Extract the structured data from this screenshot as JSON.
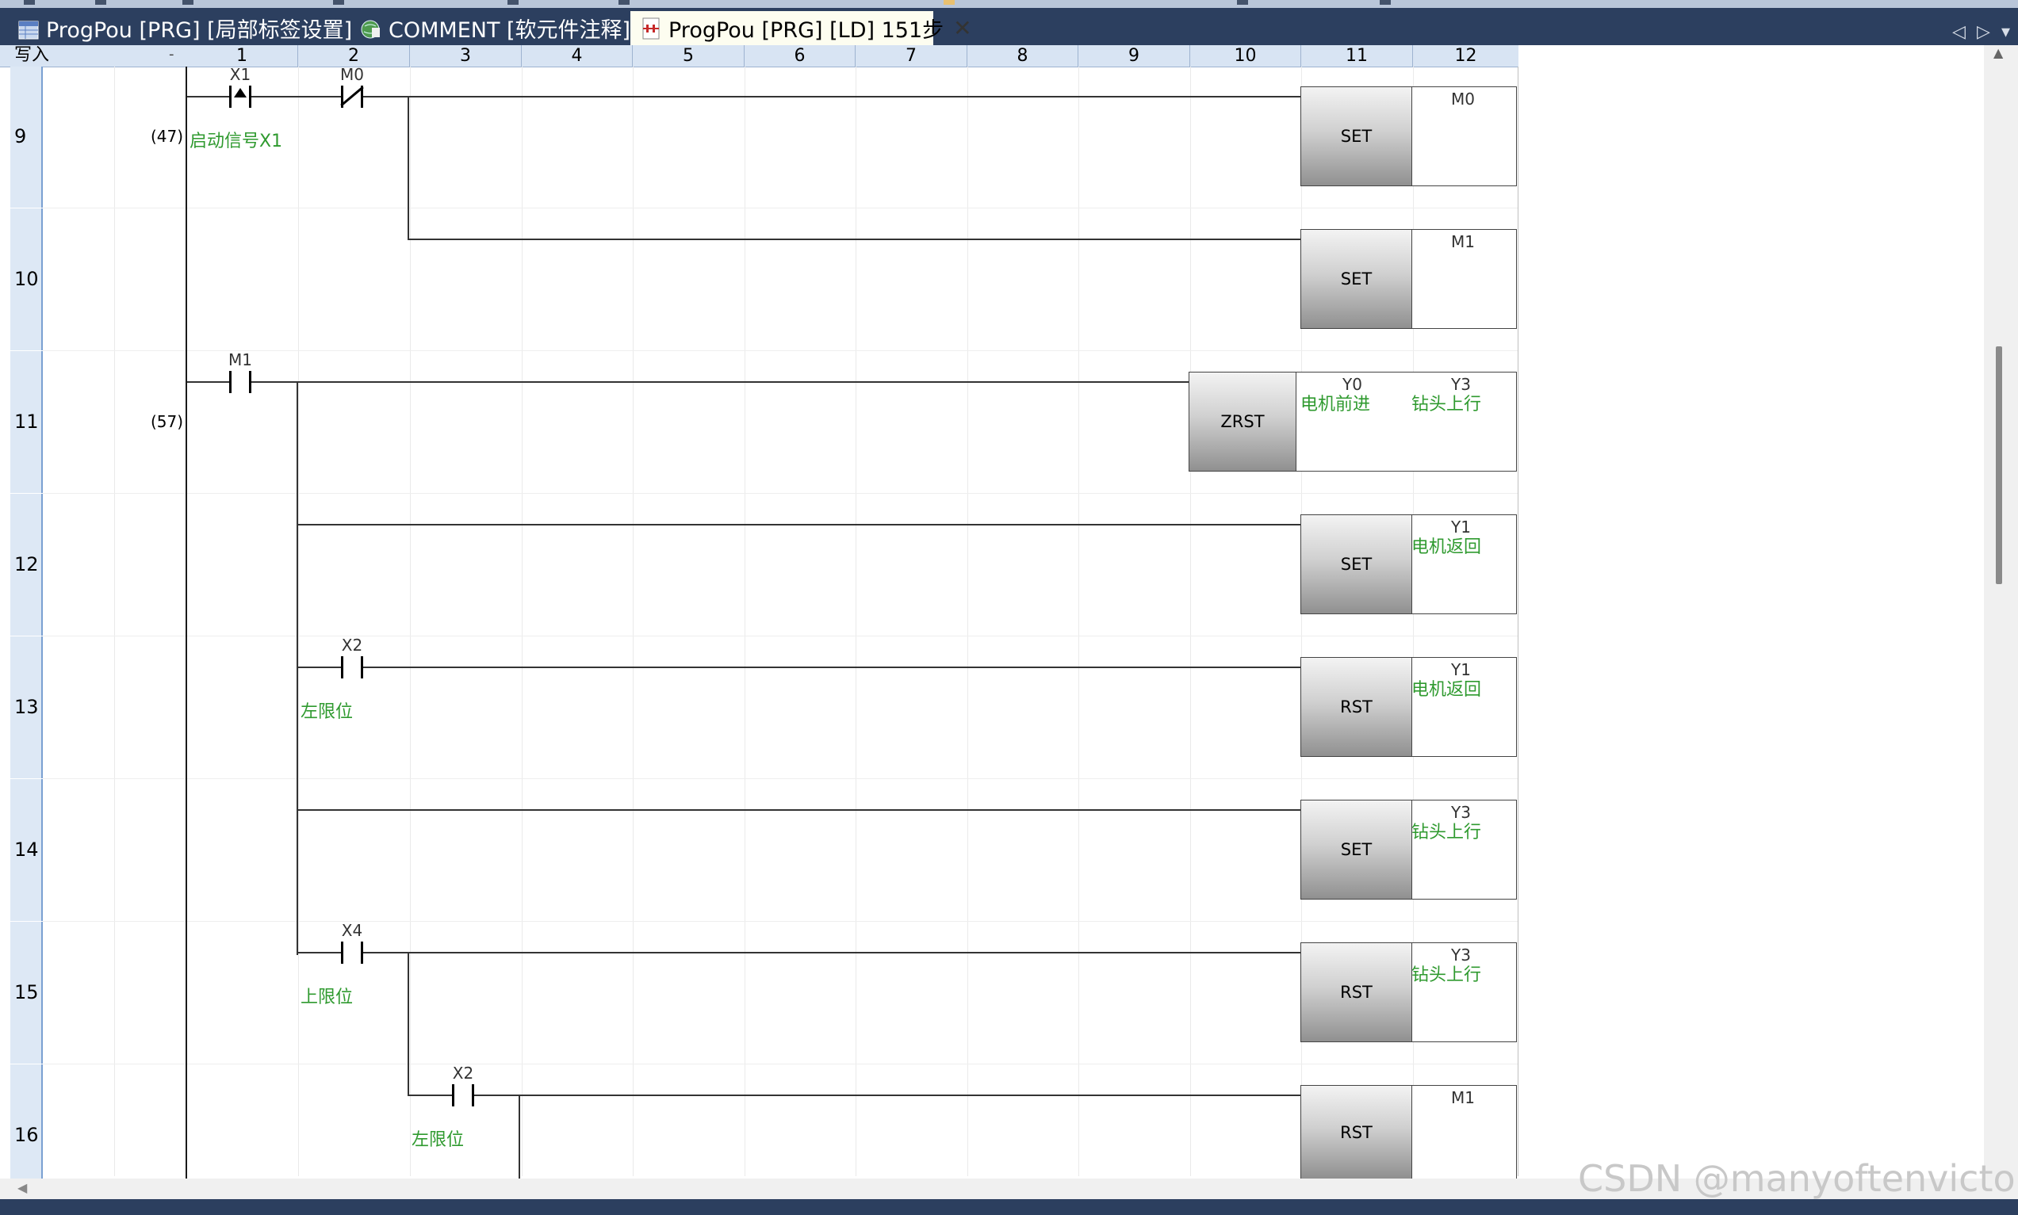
{
  "tabs": [
    {
      "label": "ProgPou [PRG] [局部标签设置]",
      "active": false,
      "icon": "label-table-icon"
    },
    {
      "label": "COMMENT [软元件注释]",
      "active": false,
      "icon": "globe-comment-icon"
    },
    {
      "label": "ProgPou [PRG] [LD] 151步",
      "active": true,
      "icon": "ladder-doc-icon"
    }
  ],
  "header": {
    "mode_label": "写入",
    "dash": "-",
    "columns": [
      "1",
      "2",
      "3",
      "4",
      "5",
      "6",
      "7",
      "8",
      "9",
      "10",
      "11",
      "12"
    ]
  },
  "rows": [
    "9",
    "10",
    "11",
    "12",
    "13",
    "14",
    "15",
    "16"
  ],
  "steps": [
    "(47)",
    "(57)"
  ],
  "contacts": [
    {
      "device": "X1",
      "type": "rising-edge",
      "comment": "启动信号X1"
    },
    {
      "device": "M0",
      "type": "normally-closed",
      "comment": ""
    },
    {
      "device": "M1",
      "type": "normally-open",
      "comment": ""
    },
    {
      "device": "X2",
      "type": "normally-open",
      "comment": "左限位"
    },
    {
      "device": "X4",
      "type": "normally-open",
      "comment": "上限位"
    },
    {
      "device": "X2",
      "type": "normally-open",
      "comment": "左限位"
    }
  ],
  "instructions": [
    {
      "op": "SET",
      "operand": "M0",
      "comment": ""
    },
    {
      "op": "SET",
      "operand": "M1",
      "comment": ""
    },
    {
      "op": "ZRST",
      "operand1": "Y0",
      "comment1": "电机前进",
      "operand": "Y3",
      "comment": "钻头上行"
    },
    {
      "op": "SET",
      "operand": "Y1",
      "comment": "电机返回"
    },
    {
      "op": "RST",
      "operand": "Y1",
      "comment": "电机返回"
    },
    {
      "op": "SET",
      "operand": "Y3",
      "comment": "钻头上行"
    },
    {
      "op": "RST",
      "operand": "Y3",
      "comment": "钻头上行"
    },
    {
      "op": "RST",
      "operand": "M1",
      "comment": ""
    }
  ],
  "watermark": "CSDN @manyoftenvictory",
  "colors": {
    "tabbar": "#2c3f5f",
    "active_tab": "#fdfdf0",
    "comment_green": "#2f9a2f",
    "header": "#d8e4f3"
  }
}
